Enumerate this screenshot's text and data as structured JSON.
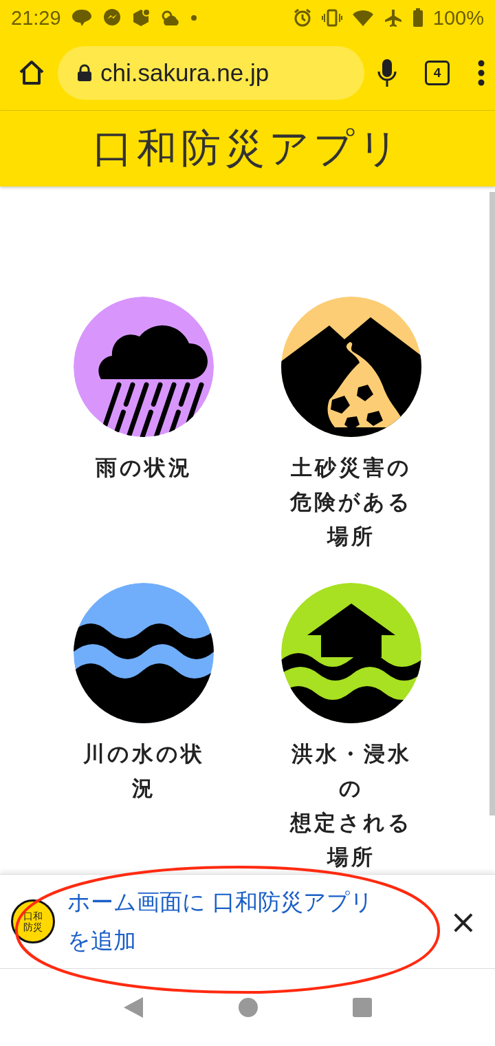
{
  "status_bar": {
    "time": "21:29",
    "battery": "100%"
  },
  "browser": {
    "url": "chi.sakura.ne.jp",
    "tab_count": "4"
  },
  "header": {
    "title": "口和防災アプリ"
  },
  "tiles": [
    {
      "kind": "rain",
      "color": "#d896fc",
      "label": [
        "雨の状況"
      ]
    },
    {
      "kind": "landslide",
      "color": "#fccd74",
      "label": [
        "土砂災害の",
        "危険がある",
        "場所"
      ]
    },
    {
      "kind": "river",
      "color": "#70aefc",
      "label": [
        "川の水の状",
        "況"
      ]
    },
    {
      "kind": "flood",
      "color": "#a8e022",
      "label": [
        "洪水・浸水",
        "の",
        "想定される",
        "場所"
      ]
    }
  ],
  "install_banner": {
    "icon_text": [
      "口和",
      "防災"
    ],
    "text": [
      "ホーム画面に 口和防災アプリ",
      "を追加"
    ],
    "close": "×"
  }
}
